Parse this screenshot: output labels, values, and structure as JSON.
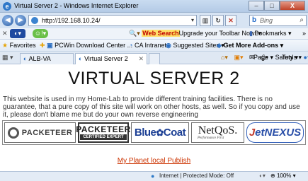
{
  "window": {
    "title": "Virtual Server 2 - Windows Internet Explorer",
    "controls": [
      "–",
      "□",
      "X"
    ]
  },
  "address_bar": {
    "url": "http://192.168.10.24/",
    "search_placeholder": "Bing"
  },
  "toolbar": {
    "search_label": "Web Search",
    "upgrade_label": "Upgrade your Toolbar Now!",
    "bookmarks_label": "Bookmarks",
    "more": "»"
  },
  "favorites_bar": {
    "favorites_label": "Favorites",
    "items": [
      "PCWin Download Center ...",
      "CA Intranet",
      "Suggested Sites ▾",
      "Get More Add-ons ▾"
    ]
  },
  "tabs": {
    "items": [
      {
        "label": "ALB-VA"
      },
      {
        "label": "Virtual Server 2"
      }
    ],
    "commands": [
      "Page ▾",
      "Safety ▾",
      "Tools ▾"
    ]
  },
  "page": {
    "heading": "VIRTUAL SERVER 2",
    "description": "This website is used in my Home-Lab to provide different training facilities. There is no guarantee, that a pure copy of this site will work on other hosts, as well. So if you copy and use it, please don't blame me but do your own reverse engineering",
    "logos": {
      "packeteer": "PACKETEER",
      "cert_title": "PACKETEER",
      "cert_sub": "CERTIFIED EXPERT",
      "bluecoat_1": "Blue",
      "bluecoat_2": "Coat",
      "netqos": "NetQoS.",
      "netqos_tag": "Performance First",
      "jetnexus_1": "J",
      "jetnexus_2": "etNEXUS"
    },
    "link": "My Planet local Publish"
  },
  "status_bar": {
    "zone": "Internet | Protected Mode: Off",
    "zoom": "100%"
  },
  "colors": {
    "link": "#cc3300",
    "bluecoat": "#1c3f94",
    "jetnexus": "#2a4fa8",
    "chrome": "#d7e4f3"
  }
}
